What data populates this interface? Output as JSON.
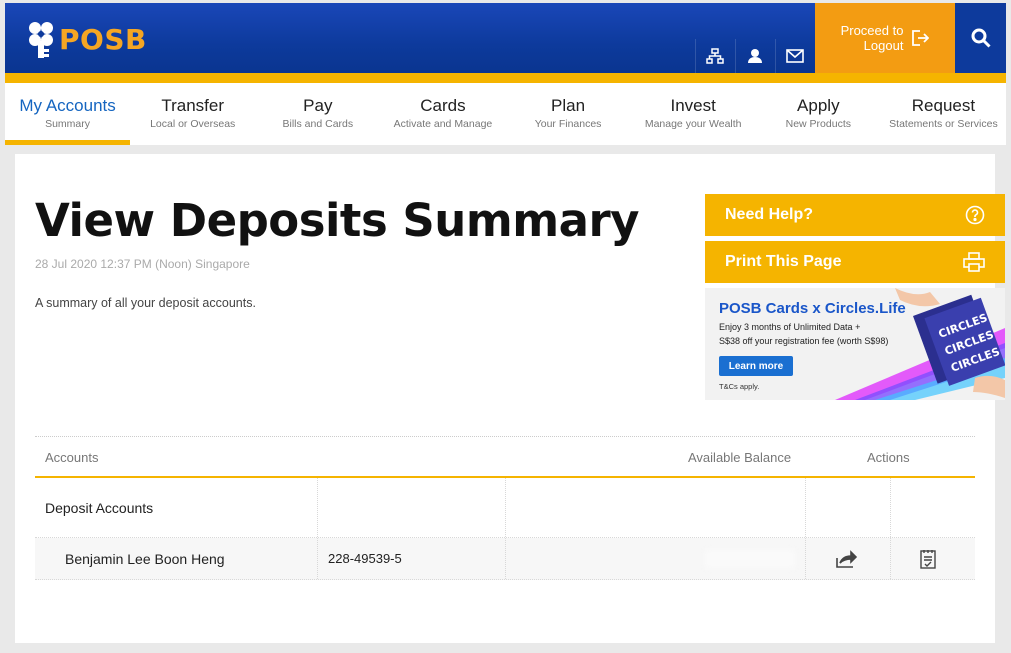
{
  "brand": {
    "name": "POSB"
  },
  "header": {
    "logout_line1": "Proceed to",
    "logout_line2": "Logout"
  },
  "nav": {
    "items": [
      {
        "title": "My Accounts",
        "sub": "Summary",
        "active": true
      },
      {
        "title": "Transfer",
        "sub": "Local or Overseas"
      },
      {
        "title": "Pay",
        "sub": "Bills and Cards"
      },
      {
        "title": "Cards",
        "sub": "Activate and Manage"
      },
      {
        "title": "Plan",
        "sub": "Your Finances"
      },
      {
        "title": "Invest",
        "sub": "Manage your Wealth"
      },
      {
        "title": "Apply",
        "sub": "New Products"
      },
      {
        "title": "Request",
        "sub": "Statements or Services"
      }
    ]
  },
  "page": {
    "title": "View Deposits Summary",
    "timestamp": "28 Jul 2020 12:37 PM (Noon) Singapore",
    "description": "A summary of all your deposit accounts."
  },
  "sidebar": {
    "help_label": "Need Help?",
    "print_label": "Print This Page",
    "banner": {
      "title": "POSB Cards x Circles.Life",
      "line1": "Enjoy 3 months of Unlimited Data +",
      "line2": "S$38 off your registration fee (worth S$98)",
      "button": "Learn more",
      "tc": "T&Cs apply."
    }
  },
  "table": {
    "headers": {
      "accounts": "Accounts",
      "balance": "Available Balance",
      "actions": "Actions"
    },
    "group_label": "Deposit Accounts",
    "rows": [
      {
        "name": "Benjamin Lee Boon Heng",
        "number": "228-49539-5"
      }
    ]
  },
  "colors": {
    "brand_blue": "#0d3a9c",
    "accent_yellow": "#f5b400",
    "logout_orange": "#f39c12"
  }
}
